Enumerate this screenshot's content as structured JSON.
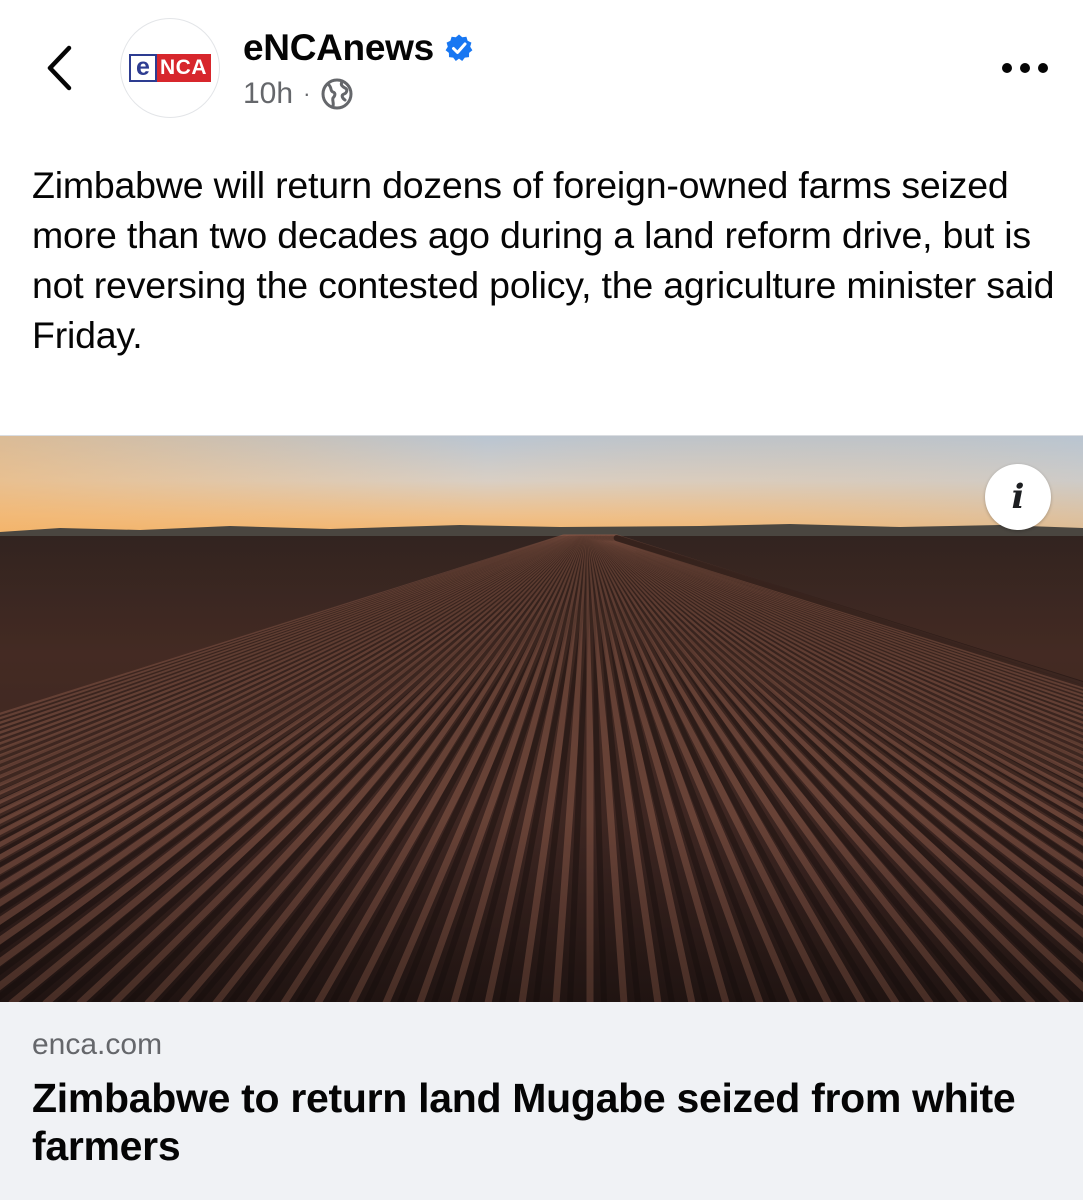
{
  "header": {
    "page_name": "eNCAnews",
    "timestamp": "10h",
    "separator": "·",
    "logo": {
      "e": "e",
      "nca": "NCA"
    },
    "verified_color": "#1877f2"
  },
  "post": {
    "text": "Zimbabwe will return dozens of foreign-owned farms seized more than two decades ago during a land reform drive, but is not reversing the contested policy, the agriculture minister said Friday."
  },
  "link_preview": {
    "image_subject": "ploughed farm field rows at sunset",
    "info_glyph": "i",
    "domain": "enca.com",
    "title": "Zimbabwe to return land Mugabe seized from white farmers"
  },
  "colors": {
    "secondary_text": "#65676b",
    "footer_bg": "#f0f2f5",
    "logo_blue": "#2d3c91",
    "logo_red": "#d7262c"
  }
}
